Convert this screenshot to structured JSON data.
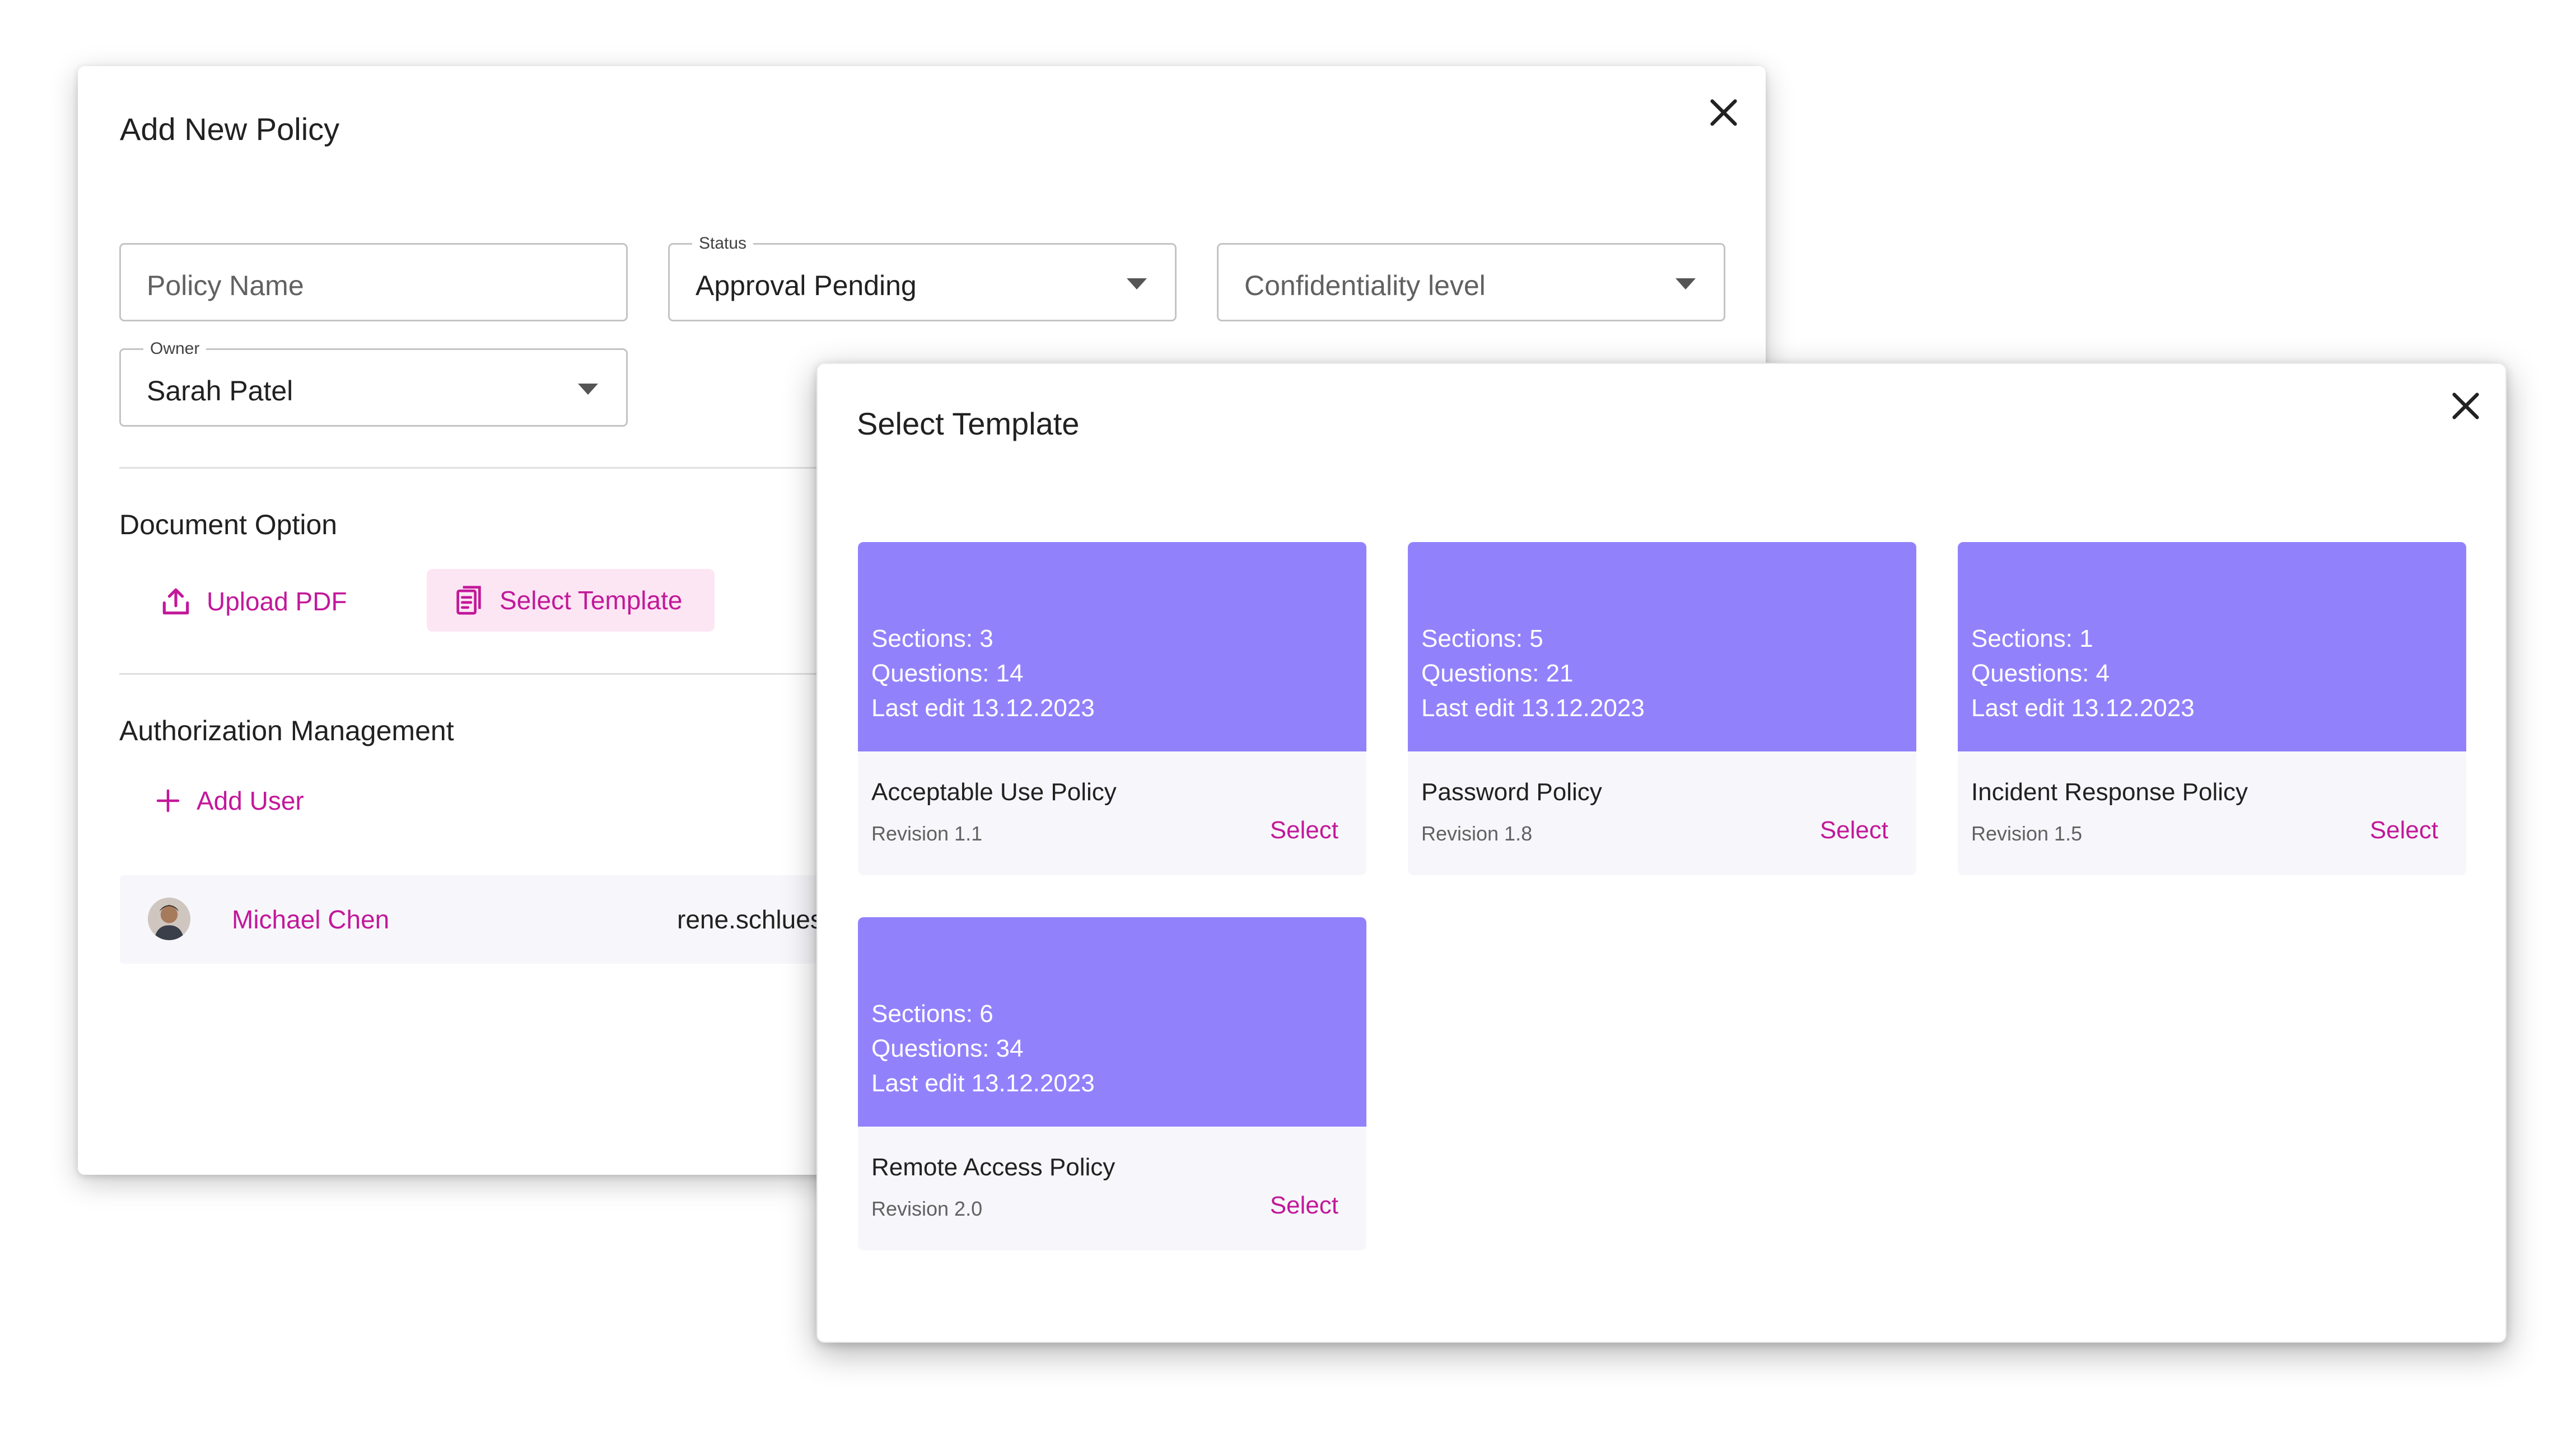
{
  "policy_dialog": {
    "title": "Add New Policy",
    "fields": {
      "policy_name": {
        "placeholder": "Policy Name"
      },
      "status": {
        "label": "Status",
        "value": "Approval Pending"
      },
      "confidentiality": {
        "placeholder": "Confidentiality level"
      },
      "owner": {
        "label": "Owner",
        "value": "Sarah Patel"
      }
    },
    "document_option": {
      "title": "Document Option",
      "upload_label": "Upload PDF",
      "template_label": "Select Template"
    },
    "authorization": {
      "title": "Authorization Management",
      "add_user_label": "Add User",
      "users": [
        {
          "name": "Michael Chen",
          "email": "rene.schluess@"
        }
      ]
    }
  },
  "template_dialog": {
    "title": "Select Template",
    "templates": [
      {
        "sections": "Sections: 3",
        "questions": "Questions: 14",
        "last_edit": "Last edit 13.12.2023",
        "name": "Acceptable Use Policy",
        "revision": "Revision 1.1",
        "action": "Select"
      },
      {
        "sections": "Sections: 5",
        "questions": "Questions: 21",
        "last_edit": "Last edit 13.12.2023",
        "name": "Password Policy",
        "revision": "Revision 1.8",
        "action": "Select"
      },
      {
        "sections": "Sections: 1",
        "questions": "Questions: 4",
        "last_edit": "Last edit 13.12.2023",
        "name": "Incident Response Policy",
        "revision": "Revision 1.5",
        "action": "Select"
      },
      {
        "sections": "Sections: 6",
        "questions": "Questions: 34",
        "last_edit": "Last edit 13.12.2023",
        "name": "Remote Access Policy",
        "revision": "Revision 2.0",
        "action": "Select"
      }
    ]
  },
  "colors": {
    "accent": "#c2189a",
    "card_header": "#9182fc",
    "active_button_bg": "#fde6f4"
  },
  "icons": {
    "close": "close-icon",
    "upload": "upload-icon",
    "template": "document-template-icon",
    "add": "plus-icon",
    "dropdown": "caret-down-icon"
  }
}
